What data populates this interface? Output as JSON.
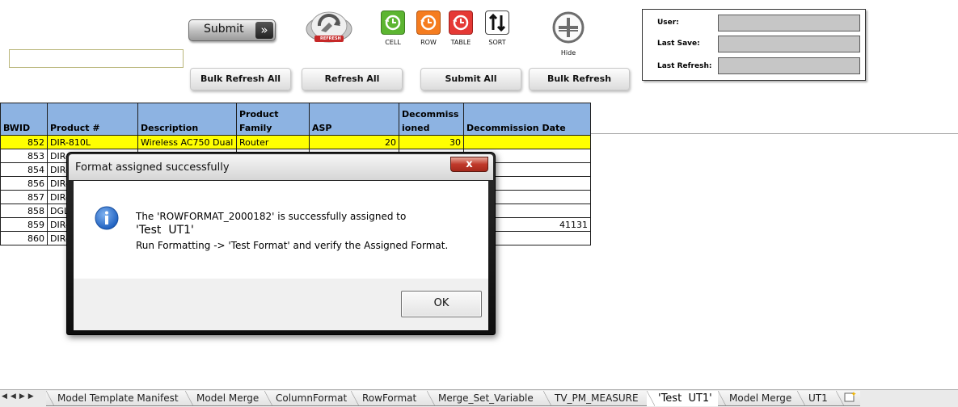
{
  "toolbar": {
    "submit_label": "Submit",
    "refresh_caption": "REFRESH",
    "icons": [
      {
        "name": "cell-refresh-icon",
        "caption": "CELL",
        "color": "#5cb531"
      },
      {
        "name": "row-refresh-icon",
        "caption": "ROW",
        "color": "#f57c1f"
      },
      {
        "name": "table-refresh-icon",
        "caption": "TABLE",
        "color": "#e53935"
      },
      {
        "name": "sort-icon",
        "caption": "SORT",
        "color": "#ffffff"
      }
    ],
    "hide_caption": "Hide",
    "buttons": [
      "Bulk Refresh All",
      "Refresh All",
      "Submit All",
      "Bulk Refresh"
    ]
  },
  "info_panel": {
    "user_label": "User:",
    "last_save_label": "Last Save:",
    "last_refresh_label": "Last Refresh:"
  },
  "grid": {
    "headers": [
      "BWID",
      "Product #",
      "Description",
      "Product Family",
      "ASP",
      "Decommissioned",
      "Decommission Date"
    ],
    "rows": [
      [
        "852",
        "DIR-810L",
        "Wireless AC750 Dual",
        "Router",
        "20",
        "30",
        ""
      ],
      [
        "853",
        "DIR-",
        "",
        "",
        "",
        "",
        ""
      ],
      [
        "854",
        "DIR-",
        "",
        "",
        "",
        "",
        ""
      ],
      [
        "856",
        "DIR-",
        "",
        "",
        "",
        "",
        ""
      ],
      [
        "857",
        "DIR-",
        "",
        "",
        "",
        "",
        ""
      ],
      [
        "858",
        "DGL",
        "",
        "",
        "",
        "",
        ""
      ],
      [
        "859",
        "DIR-",
        "",
        "",
        "",
        "",
        "41131"
      ],
      [
        "860",
        "DIR-",
        "",
        "",
        "",
        "",
        ""
      ]
    ],
    "highlight_color": "#ffff00",
    "header_color": "#8db3e2"
  },
  "dialog": {
    "title": "Format assigned successfully",
    "close_glyph": "x",
    "line1": "The 'ROWFORMAT_2000182' is successfully assigned to",
    "line2": "'Test  UT1'",
    "line3": "Run Formatting -> 'Test Format' and verify the Assigned Format.",
    "ok_label": "OK"
  },
  "tabs": [
    "Model Template Manifest",
    "Model Merge",
    "ColumnFormat",
    "RowFormat",
    "Merge_Set_Variable",
    "TV_PM_MEASURE",
    "'Test  UT1'",
    "Model Merge",
    "UT1"
  ],
  "active_tab_index": 6
}
